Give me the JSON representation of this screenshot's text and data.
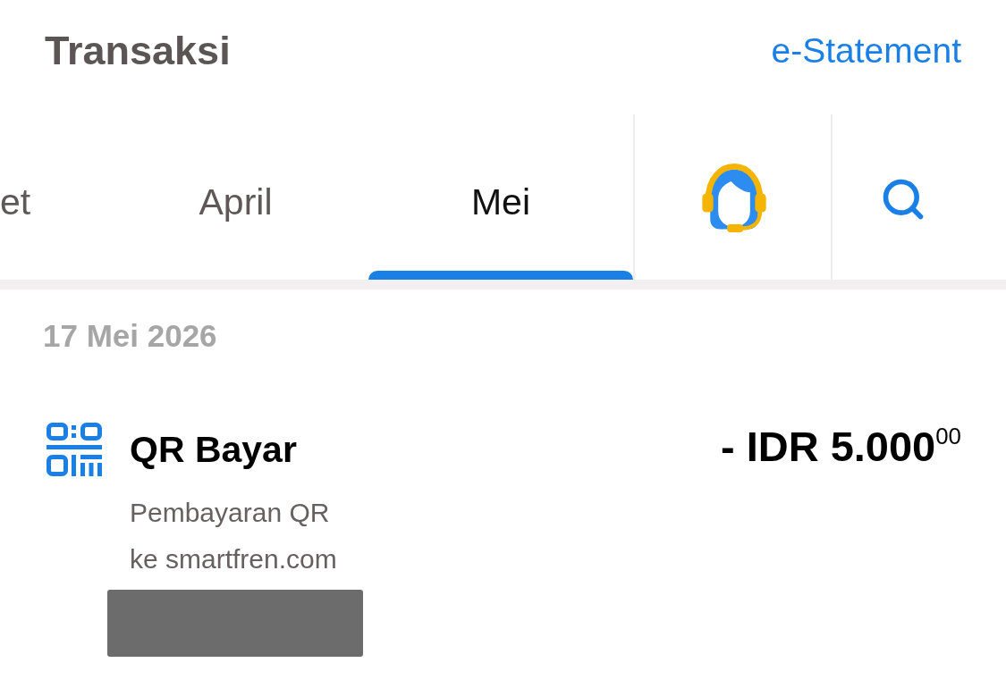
{
  "header": {
    "title": "Transaksi",
    "link": "e-Statement"
  },
  "tabs": [
    {
      "label": "et",
      "selected": false
    },
    {
      "label": "April",
      "selected": false
    },
    {
      "label": "Mei",
      "selected": true
    }
  ],
  "groups": [
    {
      "date": "17 Mei 2026",
      "transactions": [
        {
          "title": "QR Bayar",
          "amount": "- IDR 5.000$^{00}$",
          "description": [
            "Pembayaran QR",
            "ke smartfren.com"
          ]
        }
      ]
    }
  ]
}
